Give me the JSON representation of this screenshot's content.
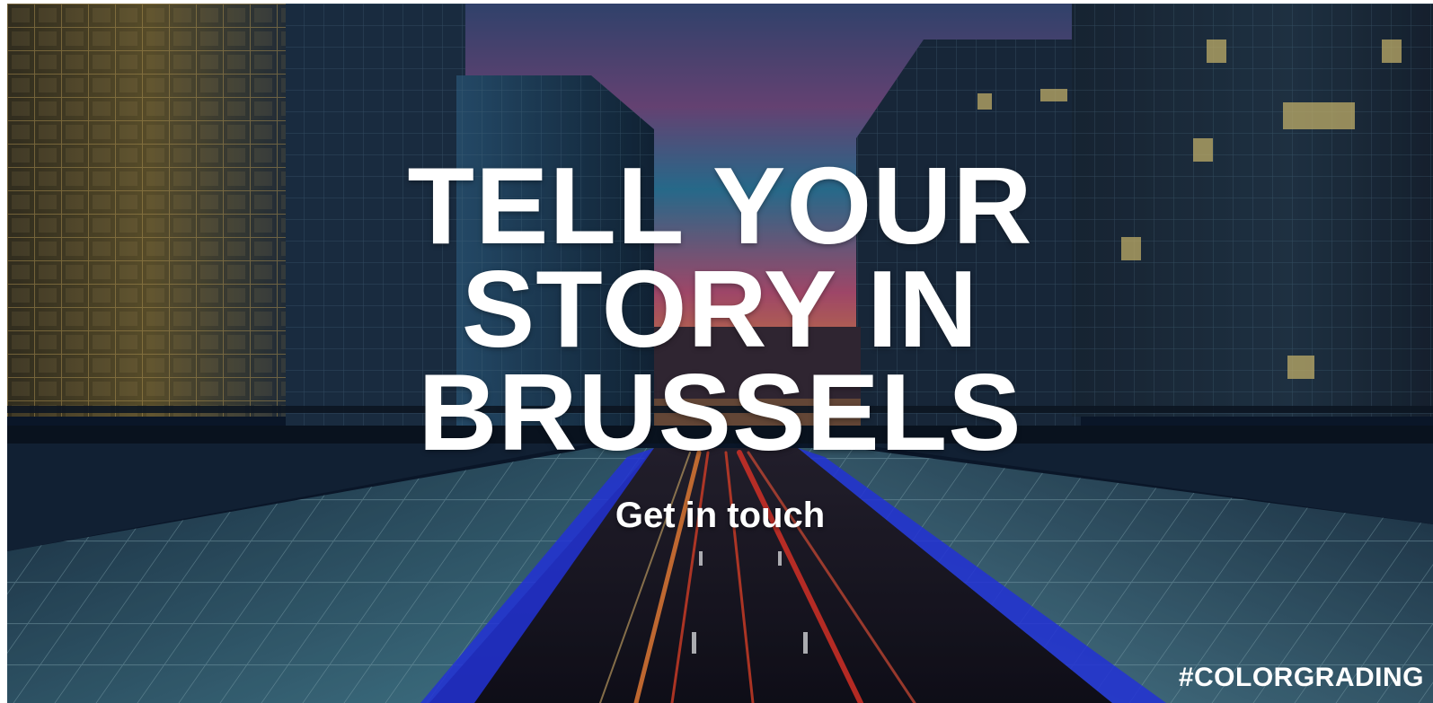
{
  "hero": {
    "headline_line1": "TELL YOUR",
    "headline_line2": "STORY IN",
    "headline_line3": "BRUSSELS",
    "cta_label": "Get in touch",
    "hashtag": "#COLORGRADING",
    "background_image": "brussels-night-boulevard-photo"
  },
  "colors": {
    "text": "#ffffff",
    "sky_top": "#3b4f7d",
    "sky_glow": "#f39a3a",
    "sky_pink": "#c1557a",
    "building_warm": "#7a6a3a",
    "building_cool": "#2c5878",
    "road_light_blue": "#2a3cff",
    "road_light_red": "#ff4a2a"
  }
}
